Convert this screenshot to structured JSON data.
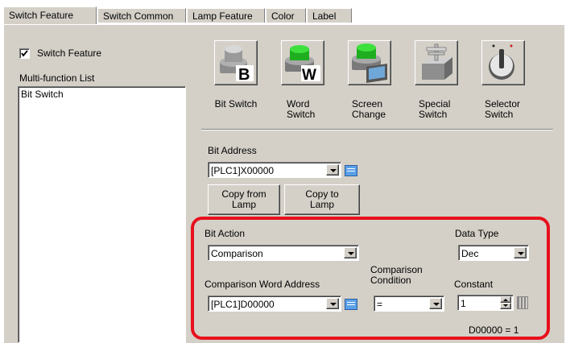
{
  "tabs": [
    "Switch Feature",
    "Switch Common",
    "Lamp Feature",
    "Color",
    "Label"
  ],
  "switch_feature_checkbox": {
    "label": "Switch Feature",
    "checked": true
  },
  "multi_function": {
    "label": "Multi-function List",
    "items": [
      "Bit Switch"
    ]
  },
  "switch_types": [
    {
      "line1": "Bit Switch",
      "line2": ""
    },
    {
      "line1": "Word",
      "line2": "Switch"
    },
    {
      "line1": "Screen",
      "line2": "Change"
    },
    {
      "line1": "Special",
      "line2": "Switch"
    },
    {
      "line1": "Selector",
      "line2": "Switch"
    }
  ],
  "bit_address": {
    "label": "Bit Address",
    "value": "[PLC1]X00000"
  },
  "copy_from_lamp": {
    "line1": "Copy from",
    "line2": "Lamp"
  },
  "copy_to_lamp": {
    "line1": "Copy to",
    "line2": "Lamp"
  },
  "bit_action": {
    "label": "Bit Action",
    "value": "Comparison"
  },
  "data_type": {
    "label": "Data Type",
    "value": "Dec"
  },
  "comparison_word_address": {
    "label": "Comparison Word Address",
    "value": "[PLC1]D00000"
  },
  "comparison_condition": {
    "line1": "Comparison",
    "line2": "Condition",
    "value": "="
  },
  "constant": {
    "label": "Constant",
    "value": "1"
  },
  "expression": "D00000 = 1",
  "highlight_color": "#e8101c"
}
